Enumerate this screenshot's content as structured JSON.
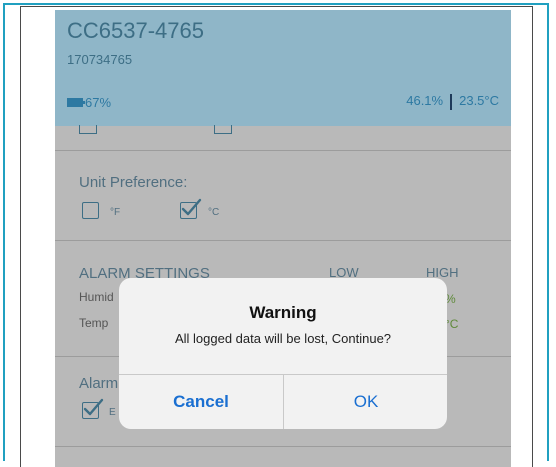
{
  "device": {
    "name": "CC6537-4765",
    "serial": "170734765",
    "battery": "67%",
    "humidity": "46.1%",
    "temperature": "23.5°C"
  },
  "unit_preference": {
    "title": "Unit Preference:",
    "options": [
      {
        "label": "°F",
        "checked": false
      },
      {
        "label": "°C",
        "checked": true
      }
    ]
  },
  "alarm_settings": {
    "title": "ALARM SETTINGS",
    "col_low": "LOW",
    "col_high": "HIGH",
    "rows": [
      {
        "label": "Humid",
        "high_partial": "%"
      },
      {
        "label": "Temp",
        "high_partial": "°C"
      }
    ]
  },
  "alarm_section": {
    "title": "Alarm",
    "option_label_partial": "E"
  },
  "dialog": {
    "title": "Warning",
    "message": "All logged data will be lost, Continue?",
    "cancel": "Cancel",
    "ok": "OK"
  },
  "colors": {
    "accent": "#1a6fd1",
    "header_bg": "#8fb6c8",
    "screen_bg": "#b9b9b9"
  }
}
